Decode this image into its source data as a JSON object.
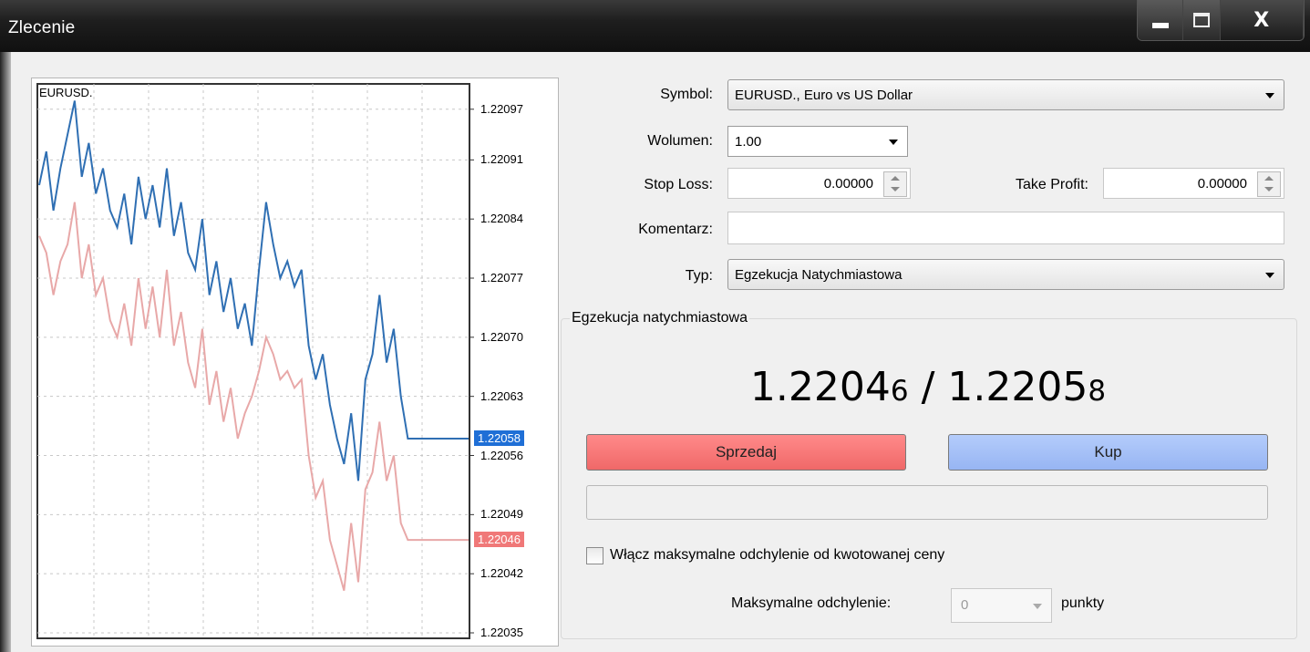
{
  "window": {
    "title": "Zlecenie",
    "close_glyph": "X"
  },
  "chart": {
    "symbol_label": "EURUSD.",
    "ticks": [
      "1.22097",
      "1.22091",
      "1.22084",
      "1.22077",
      "1.22070",
      "1.22063",
      "1.22056",
      "1.22049",
      "1.22042",
      "1.22035"
    ],
    "ask_badge": "1.22058",
    "bid_badge": "1.22046",
    "ask_color": "#2f6fb3",
    "bid_color": "#e8a8a8"
  },
  "chart_data": {
    "type": "line",
    "ylim": [
      1.22035,
      1.221
    ],
    "series": [
      {
        "values": [
          1.22088,
          1.22092,
          1.22085,
          1.2209,
          1.22094,
          1.22098,
          1.22089,
          1.22093,
          1.22087,
          1.2209,
          1.22085,
          1.22083,
          1.22087,
          1.22081,
          1.22089,
          1.22084,
          1.22088,
          1.22083,
          1.2209,
          1.22082,
          1.22086,
          1.2208,
          1.22078,
          1.22084,
          1.22075,
          1.22079,
          1.22073,
          1.22077,
          1.22071,
          1.22074,
          1.22069,
          1.22078,
          1.22086,
          1.22081,
          1.22077,
          1.22079,
          1.22076,
          1.22078,
          1.22069,
          1.22065,
          1.22068,
          1.22062,
          1.22058,
          1.22055,
          1.22061,
          1.22053,
          1.22065,
          1.22068,
          1.22075,
          1.22067,
          1.22071,
          1.22063,
          1.22058,
          1.22058,
          1.22058
        ]
      },
      {
        "values": [
          1.22082,
          1.2208,
          1.22075,
          1.22079,
          1.22081,
          1.22086,
          1.22077,
          1.22081,
          1.22075,
          1.22077,
          1.22072,
          1.2207,
          1.22074,
          1.22069,
          1.22077,
          1.22071,
          1.22076,
          1.2207,
          1.22078,
          1.22069,
          1.22073,
          1.22067,
          1.22064,
          1.22071,
          1.22062,
          1.22066,
          1.2206,
          1.22064,
          1.22058,
          1.22061,
          1.22063,
          1.22066,
          1.2207,
          1.22068,
          1.22065,
          1.22066,
          1.22064,
          1.22065,
          1.22056,
          1.22051,
          1.22053,
          1.22046,
          1.22043,
          1.2204,
          1.22048,
          1.22041,
          1.22052,
          1.22054,
          1.2206,
          1.22053,
          1.22056,
          1.22048,
          1.22046,
          1.22046,
          1.22046
        ]
      }
    ]
  },
  "form": {
    "symbol_label": "Symbol:",
    "symbol_value": "EURUSD., Euro vs US Dollar",
    "volume_label": "Wolumen:",
    "volume_value": "1.00",
    "stop_loss_label": "Stop Loss:",
    "stop_loss_value": "0.00000",
    "take_profit_label": "Take Profit:",
    "take_profit_value": "0.00000",
    "comment_label": "Komentarz:",
    "comment_value": "",
    "type_label": "Typ:",
    "type_value": "Egzekucja Natychmiastowa"
  },
  "execution": {
    "group_title": "Egzekucja natychmiastowa",
    "bid_main": "1.2204",
    "bid_small": "6",
    "separator": " / ",
    "ask_main": "1.2205",
    "ask_small": "8",
    "sell_label": "Sprzedaj",
    "buy_label": "Kup",
    "max_dev_checkbox_label": "Włącz maksymalne odchylenie od kwotowanej ceny",
    "max_dev_label": "Maksymalne odchylenie:",
    "max_dev_value": "0",
    "max_dev_unit": "punkty"
  }
}
